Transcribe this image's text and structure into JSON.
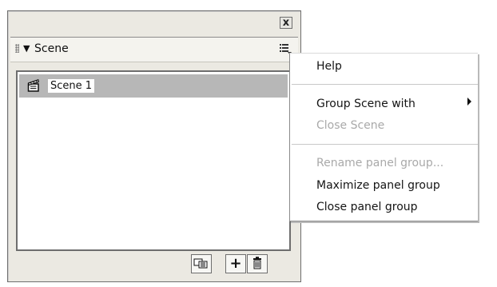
{
  "window": {
    "close_glyph": "x"
  },
  "panel": {
    "collapse_glyph": "▼",
    "title": "Scene"
  },
  "scenes": [
    {
      "label": "Scene 1",
      "selected": true
    }
  ],
  "footer": {
    "buttons": [
      {
        "icon": "duplicate-scene-icon"
      },
      {
        "icon": "add-scene-icon",
        "glyph": "+"
      },
      {
        "icon": "delete-scene-icon"
      }
    ]
  },
  "menu": {
    "items": [
      {
        "label": "Help",
        "enabled": true
      },
      {
        "label": "Group Scene with",
        "enabled": true,
        "has_submenu": true
      },
      {
        "label": "Close Scene",
        "enabled": false
      },
      {
        "label": "Rename panel group...",
        "enabled": false
      },
      {
        "label": "Maximize panel group",
        "enabled": true
      },
      {
        "label": "Close panel group",
        "enabled": true
      }
    ]
  },
  "colors": {
    "window_bg": "#ebe9e2",
    "selection": "#b7b7b7",
    "disabled_text": "#a9a9a9"
  }
}
